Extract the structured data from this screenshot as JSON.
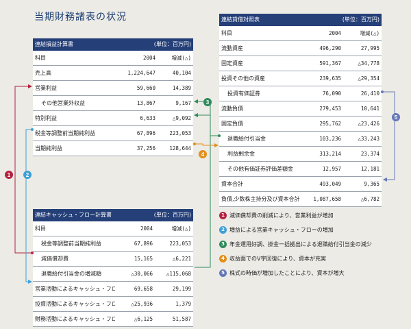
{
  "title": "当期財務諸表の状況",
  "colors": {
    "header_bg": "#253f78",
    "badge1": "#b3223f",
    "badge2": "#3da0d5",
    "badge3": "#2f8b5a",
    "badge4": "#e38f1a",
    "badge5": "#6678b8"
  },
  "income": {
    "header": "連結損益計算書",
    "unit": "(単位：百万円)",
    "rows": [
      {
        "label": "科目",
        "v1": "2004",
        "v2": "増減(△)"
      },
      {
        "label": "売上高",
        "v1": "1,224,647",
        "v2": "40,104"
      },
      {
        "label": "営業利益",
        "v1": "59,660",
        "v2": "14,389"
      },
      {
        "label": "その他営業外収益",
        "v1": "13,867",
        "v2": "9,167"
      },
      {
        "label": "特別利益",
        "v1": "6,633",
        "v2": "△9,092"
      },
      {
        "label": "税金等調整前当期純利益",
        "v1": "67,896",
        "v2": "223,053"
      },
      {
        "label": "当期純利益",
        "v1": "37,256",
        "v2": "128,644"
      }
    ]
  },
  "cashflow": {
    "header": "連結キャッシュ・フロー計算書",
    "unit": "(単位：百万円)",
    "rows": [
      {
        "label": "科目",
        "v1": "2004",
        "v2": "増減(△)"
      },
      {
        "label": "税金等調整前当期純利益",
        "v1": "67,896",
        "v2": "223,053"
      },
      {
        "label": "減価償却費",
        "v1": "15,165",
        "v2": "△6,221"
      },
      {
        "label": "退職給付引当金の増減額",
        "v1": "△30,066",
        "v2": "△115,068"
      },
      {
        "label": "営業活動によるキャッシュ・フロー",
        "v1": "69,658",
        "v2": "29,199"
      },
      {
        "label": "投資活動によるキャッシュ・フロー",
        "v1": "△25,936",
        "v2": "1,379"
      },
      {
        "label": "財務活動によるキャッシュ・フロー",
        "v1": "△6,125",
        "v2": "51,587"
      }
    ]
  },
  "balance": {
    "header": "連結貸借対照表",
    "unit": "(単位：百万円)",
    "rows": [
      {
        "label": "科目",
        "v1": "2004",
        "v2": "増減(△)"
      },
      {
        "label": "流動資産",
        "v1": "496,290",
        "v2": "27,995"
      },
      {
        "label": "固定資産",
        "v1": "591,367",
        "v2": "△34,778"
      },
      {
        "label": "投資その他の資産",
        "v1": "239,635",
        "v2": "△29,354"
      },
      {
        "label": "投資有価証券",
        "v1": "76,090",
        "v2": "26,410"
      },
      {
        "label": "流動負債",
        "v1": "279,453",
        "v2": "10,641"
      },
      {
        "label": "固定負債",
        "v1": "295,762",
        "v2": "△23,426"
      },
      {
        "label": "退職給付引当金",
        "v1": "103,236",
        "v2": "△33,243"
      },
      {
        "label": "利益剰余金",
        "v1": "313,214",
        "v2": "23,374"
      },
      {
        "label": "その他有価証券評価差額金",
        "v1": "12,957",
        "v2": "12,181"
      },
      {
        "label": "資本合計",
        "v1": "493,049",
        "v2": "9,365"
      },
      {
        "label": "負債,少数株主持分及び資本合計",
        "v1": "1,087,658",
        "v2": "△6,782"
      }
    ]
  },
  "badges": [
    "1",
    "2",
    "3",
    "4",
    "5"
  ],
  "legend": [
    {
      "num": "1",
      "text": "減価償却費の削減により、営業利益が増加"
    },
    {
      "num": "2",
      "text": "増益による営業キャッシュ・フローの増加"
    },
    {
      "num": "3",
      "text": "年金運用好調、掛金一括拠出による退職給付引当金の減少"
    },
    {
      "num": "4",
      "text": "収益面でのV字回復により、資本が充実"
    },
    {
      "num": "5",
      "text": "株式の時価が増加したことにより、資本が増大"
    }
  ]
}
